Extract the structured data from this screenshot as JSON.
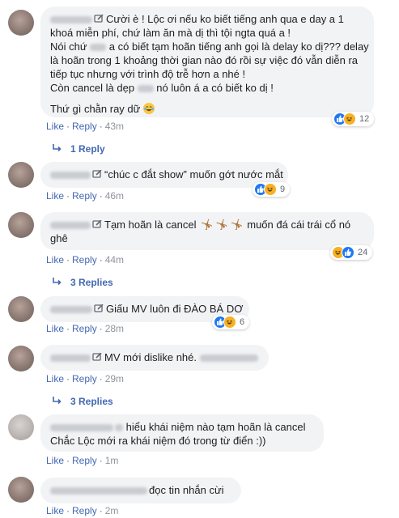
{
  "actions": {
    "like": "Like",
    "reply": "Reply",
    "separator": "·"
  },
  "comments": [
    {
      "lines": [
        "Cười è ! Lộc ơi nếu ko biết tiếng anh qua e day a 1",
        "khoá miễn phí, chứ làm ăn mà dị thì tội ngta quá a !",
        "Nói chứ ",
        " a có biết tạm hoãn tiếng anh gọi là delay ko dị??? delay",
        "là hoãn trong 1 khoảng thời gian nào đó rồi sự việc đó vẫn diễn ra",
        "tiếp tục nhưng với trình độ trễ hơn a nhé !",
        "Còn cancel là dẹp ",
        " nó luôn á a có biết ko dị !",
        "Thứ gì chằn ray dữ"
      ],
      "time": "43m",
      "reaction_count": "12",
      "replies": "1 Reply"
    },
    {
      "text": "“chúc c đắt show” muốn gớt nước mắt",
      "time": "46m",
      "reaction_count": "9"
    },
    {
      "text1": "Tạm hoãn là cancel",
      "text2": "muốn đá cái trái cổ nó",
      "text3": "ghê",
      "time": "44m",
      "reaction_count": "24",
      "replies": "3 Replies"
    },
    {
      "text": "Giấu MV luôn đi ĐÀO BÁ DƠ",
      "time": "28m",
      "reaction_count": "6"
    },
    {
      "text": "MV mới dislike nhé.",
      "time": "29m",
      "replies": "3 Replies"
    },
    {
      "line1": "hiểu khái niệm nào tạm hoãn là cancel",
      "line2": "Chắc Lộc mới ra khái niệm đó trong từ điển :))",
      "time": "1m"
    },
    {
      "text": "đọc tin nhắn cừi",
      "time": "2m"
    }
  ],
  "colors": {
    "link": "#4267b2",
    "bubble": "#f2f3f5",
    "like": "#2078f4",
    "haha": "#f7b125"
  }
}
